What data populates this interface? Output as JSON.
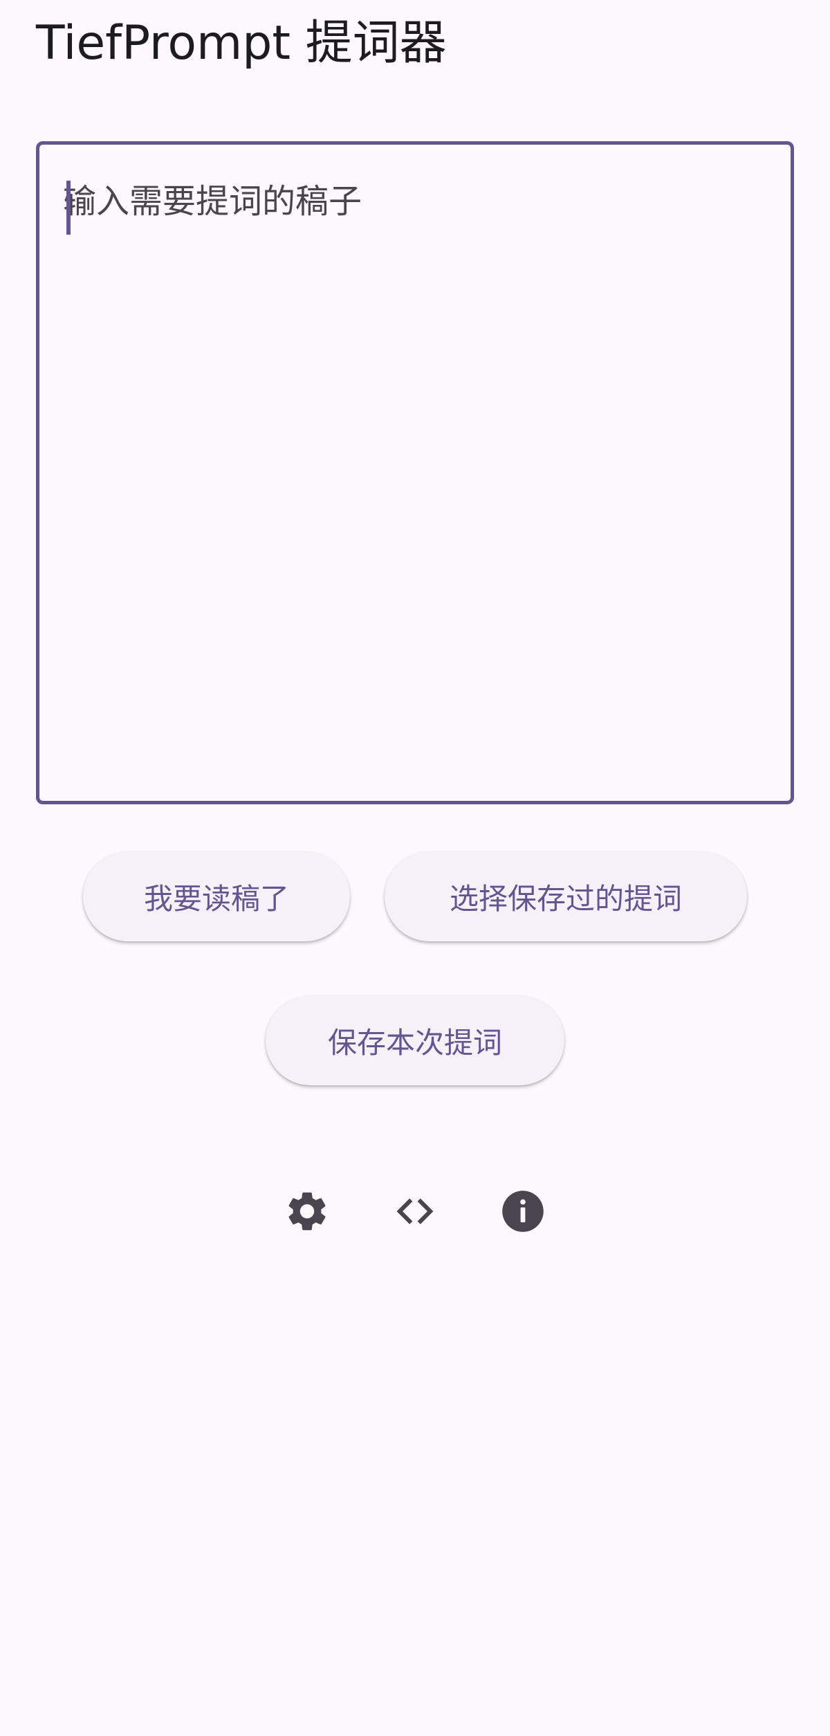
{
  "app": {
    "title": "TiefPrompt 提词器"
  },
  "editor": {
    "value": "",
    "placeholder": "输入需要提词的稿子"
  },
  "buttons": {
    "read_label": "我要读稿了",
    "choose_saved_label": "选择保存过的提词",
    "save_label": "保存本次提词"
  },
  "toolbar": {
    "icons": [
      "gear-icon",
      "code-icon",
      "info-icon"
    ]
  },
  "colors": {
    "background": "#fdf8fd",
    "accent": "#65558f",
    "button_surface": "#f4f2f8",
    "icon": "#48454e",
    "text": "#1c1b1f"
  }
}
